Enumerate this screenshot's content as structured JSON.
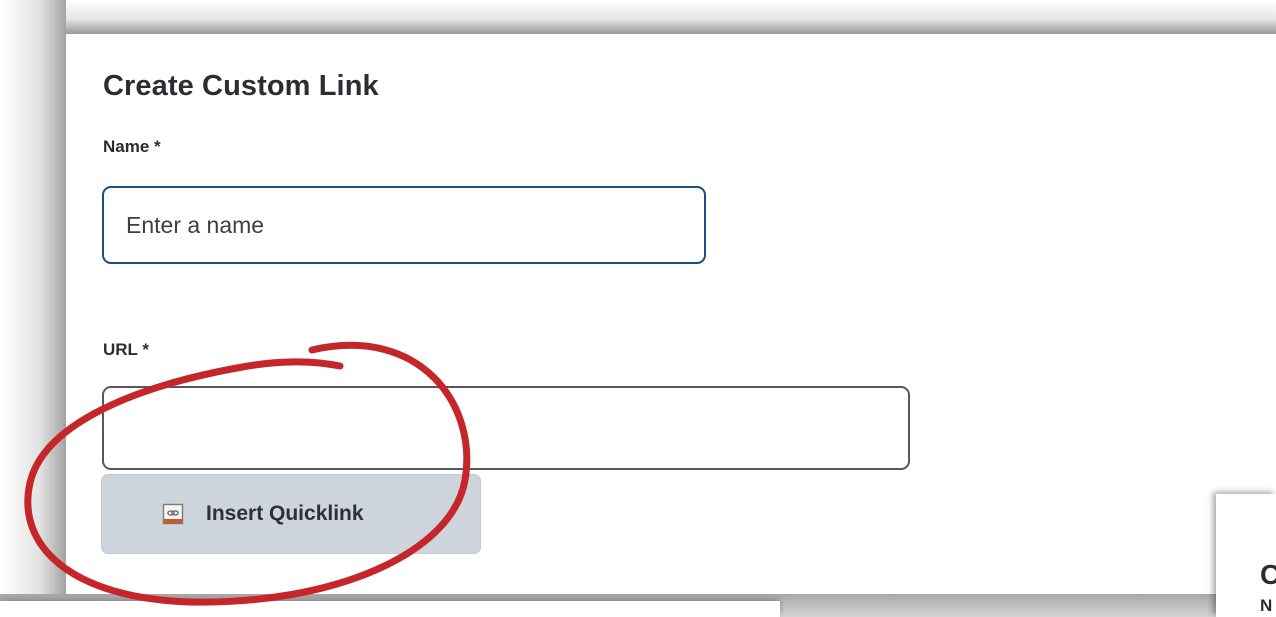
{
  "dialog": {
    "title": "Create Custom Link",
    "name_label": "Name *",
    "name_placeholder": "Enter a name",
    "url_label": "URL *",
    "url_value": "",
    "quicklink_button_label": "Insert Quicklink"
  },
  "background_panel": {
    "title_partial": "C",
    "label_partial": "N"
  },
  "colors": {
    "name_input_border": "#184e86",
    "url_input_border": "#55595e",
    "quicklink_button_bg": "#cdd4dc",
    "annotation_circle": "#c4262a"
  },
  "icons": {
    "quicklink": "quicklink-icon",
    "annotation": "red-highlight-circle"
  }
}
